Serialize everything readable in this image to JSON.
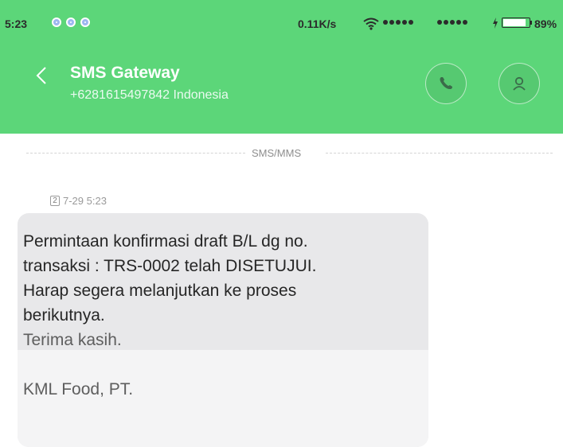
{
  "status_bar": {
    "time": "5:23",
    "network_speed": "0.11K/s",
    "battery_percent": "89%",
    "battery_level": 0.89,
    "icons": [
      "notification-icon",
      "notification-icon",
      "notification-icon",
      "wifi-icon",
      "signal-icon",
      "signal-icon",
      "charging-icon",
      "battery-icon"
    ]
  },
  "header": {
    "contact_name": "SMS Gateway",
    "contact_detail": "+6281615497842 Indonesia",
    "accent_color": "#5cd679",
    "icons": [
      "back-icon",
      "phone-icon",
      "person-icon"
    ]
  },
  "conversation": {
    "channel_label": "SMS/MMS",
    "message": {
      "sim_slot": "2",
      "timestamp": "7-29 5:23",
      "lines": [
        "Permintaan konfirmasi draft B/L dg no.",
        "transaksi : TRS-0002 telah DISETUJUI.",
        "Harap segera melanjutkan ke proses",
        "berikutnya.",
        "Terima kasih.",
        "",
        "KML Food, PT."
      ]
    }
  }
}
